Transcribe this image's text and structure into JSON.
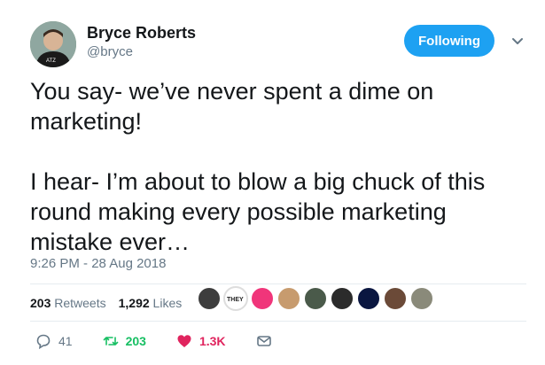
{
  "author": {
    "name": "Bryce Roberts",
    "handle": "@bryce"
  },
  "follow_button_label": "Following",
  "tweet_text": "You say- we’ve never spent a dime on marketing!\n\nI hear- I’m about to blow a big chuck of this round making every possible marketing mistake ever…",
  "timestamp": "9:26 PM - 28 Aug 2018",
  "stats": {
    "retweets_count": "203",
    "retweets_label": "Retweets",
    "likes_count": "1,292",
    "likes_label": "Likes"
  },
  "actions": {
    "reply_count": "41",
    "retweet_count": "203",
    "like_count": "1.3K"
  },
  "colors": {
    "accent": "#1da1f2",
    "retweet": "#17bf63",
    "like": "#e0245e",
    "muted": "#657786"
  }
}
